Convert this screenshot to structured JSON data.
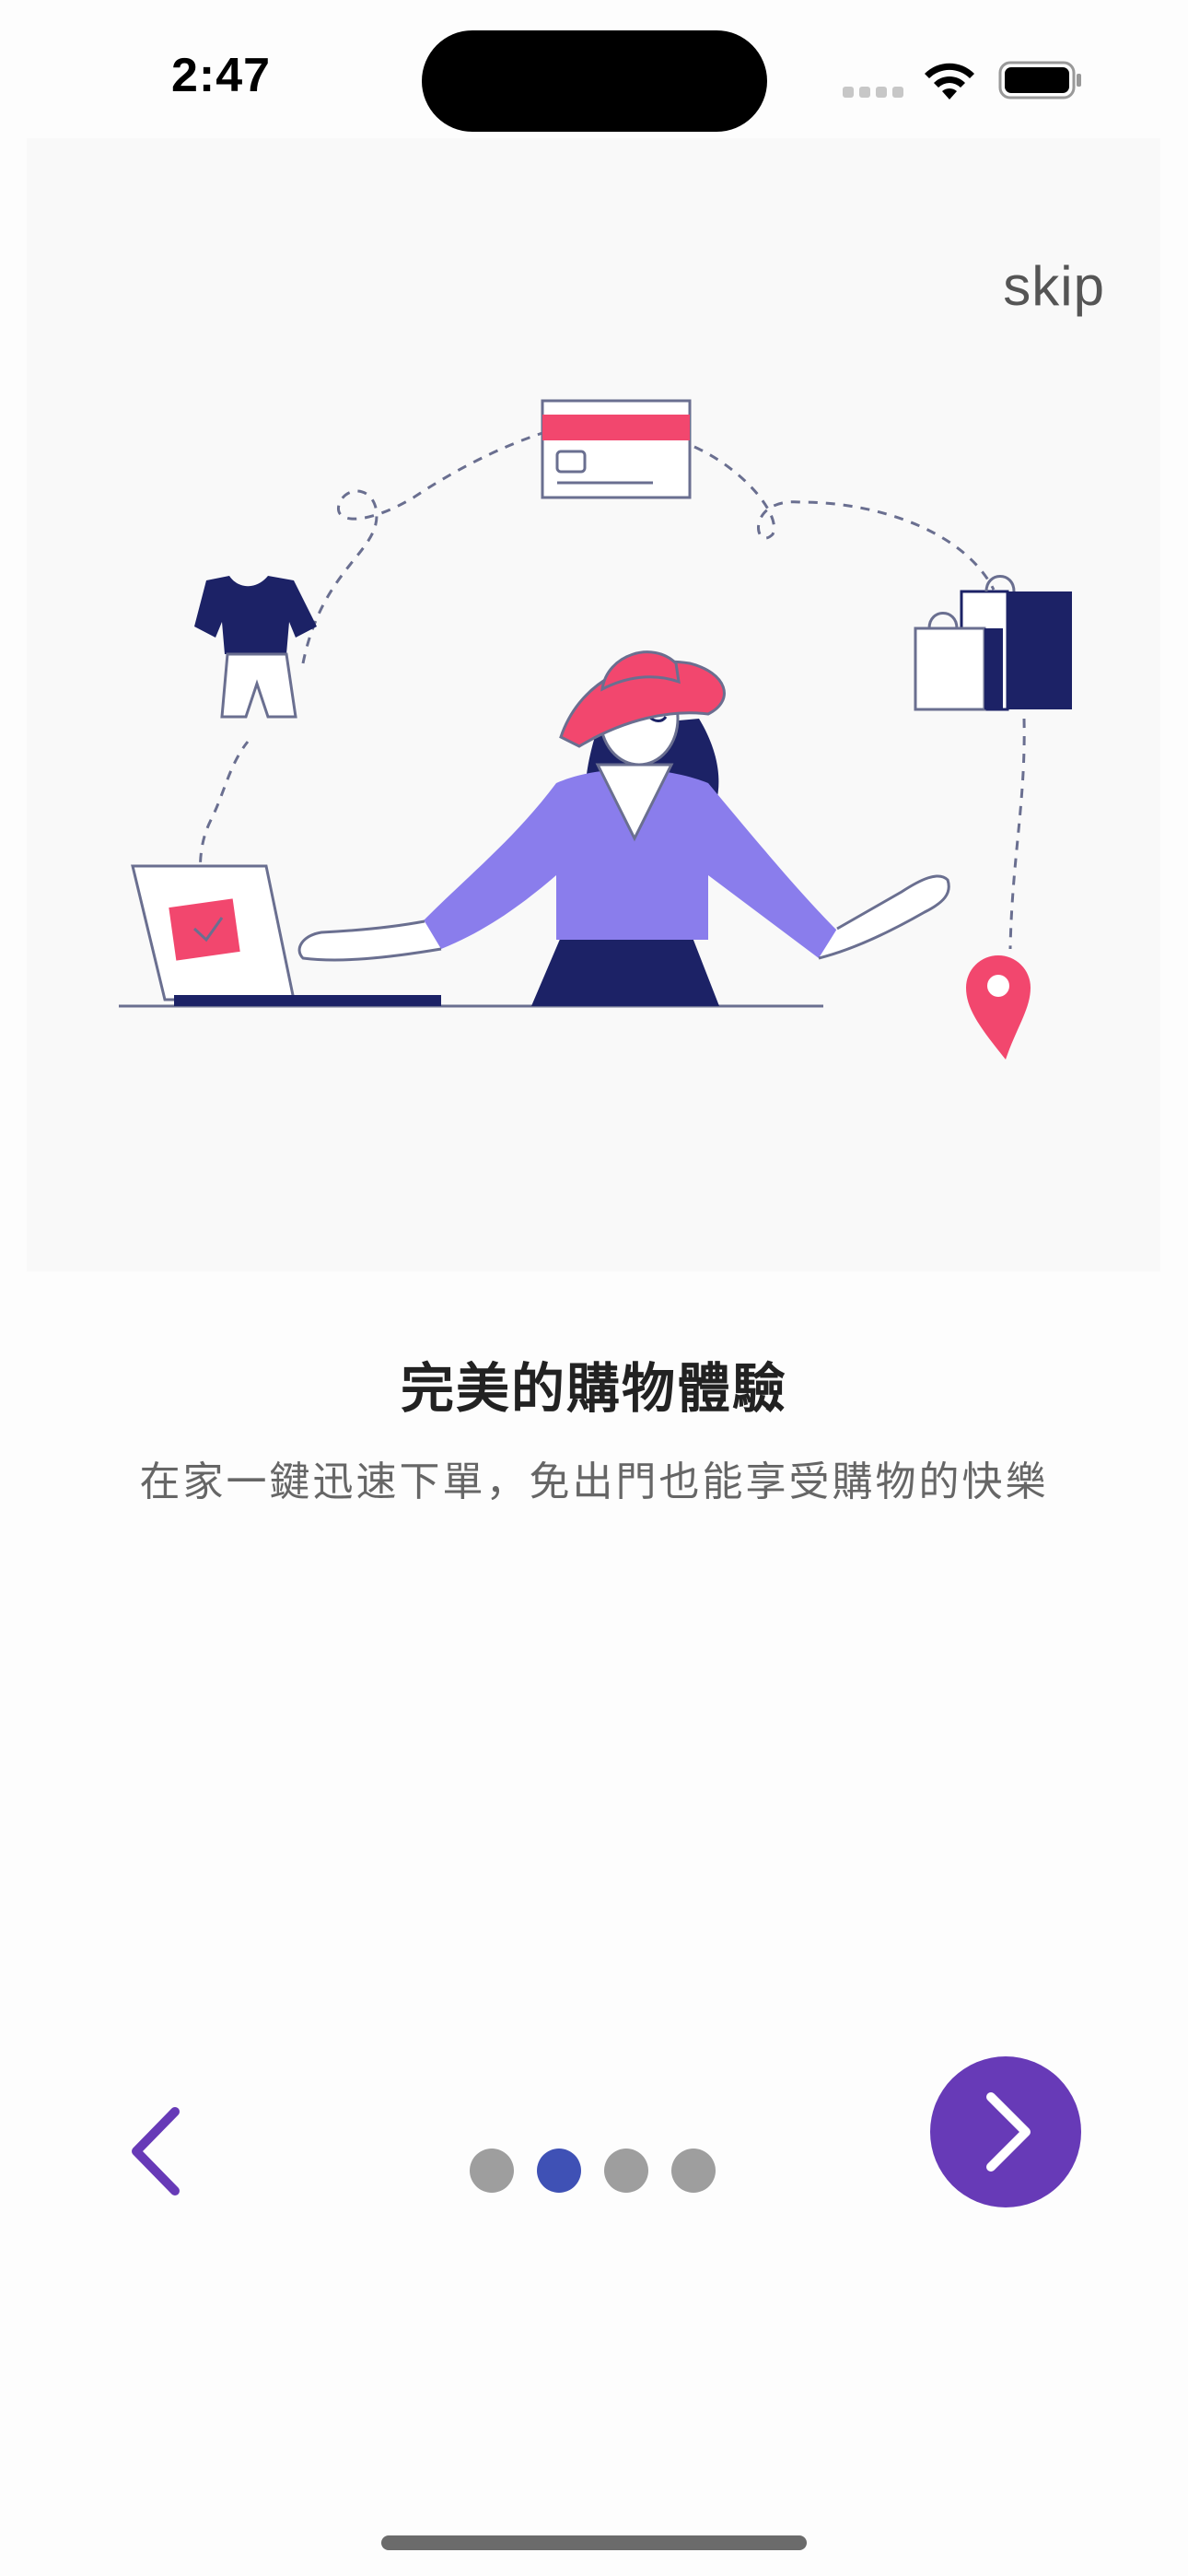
{
  "status_bar": {
    "time": "2:47"
  },
  "onboarding": {
    "skip_label": "skip",
    "title": "完美的購物體驗",
    "subtitle": "在家一鍵迅速下單，免出門也能享受購物的快樂",
    "page_count": 4,
    "current_page_index": 1
  },
  "icons": {
    "back": "chevron-left-icon",
    "next": "chevron-right-icon"
  },
  "colors": {
    "accent": "#673ab7",
    "back_arrow": "#673ab7",
    "dot_active": "#3f51b5",
    "dot_inactive": "#9e9e9e",
    "illustration_pink": "#f2476e",
    "illustration_navy": "#1c2266",
    "illustration_purple": "#8a7dec"
  }
}
